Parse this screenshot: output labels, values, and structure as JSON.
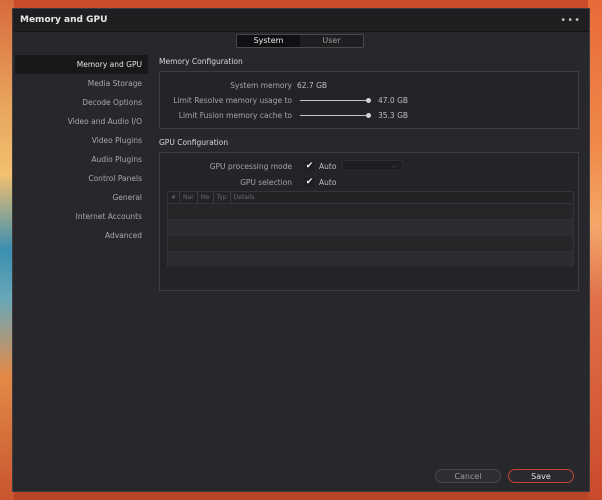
{
  "window": {
    "title": "Memory and GPU",
    "more_icon": "•••"
  },
  "tabs": [
    {
      "label": "System",
      "active": true
    },
    {
      "label": "User",
      "active": false
    }
  ],
  "sidebar": {
    "items": [
      {
        "label": "Memory and GPU",
        "active": true
      },
      {
        "label": "Media Storage"
      },
      {
        "label": "Decode Options"
      },
      {
        "label": "Video and Audio I/O"
      },
      {
        "label": "Video Plugins"
      },
      {
        "label": "Audio Plugins"
      },
      {
        "label": "Control Panels"
      },
      {
        "label": "General"
      },
      {
        "label": "Internet Accounts"
      },
      {
        "label": "Advanced"
      }
    ]
  },
  "memory": {
    "section_title": "Memory Configuration",
    "system_memory_label": "System memory",
    "system_memory_value": "62.7 GB",
    "resolve_label": "Limit Resolve memory usage to",
    "resolve_value": "47.0 GB",
    "resolve_fraction": 1.0,
    "fusion_label": "Limit Fusion memory cache to",
    "fusion_value": "35.3 GB",
    "fusion_fraction": 1.0
  },
  "gpu": {
    "section_title": "GPU Configuration",
    "processing_label": "GPU processing mode",
    "processing_auto_label": "Auto",
    "processing_auto_checked": true,
    "selection_label": "GPU selection",
    "selection_auto_label": "Auto",
    "selection_auto_checked": true,
    "table_columns": [
      "#",
      "Nar",
      "Me",
      "Typ",
      "Details"
    ]
  },
  "buttons": {
    "cancel": "Cancel",
    "save": "Save"
  },
  "colors": {
    "accent_save_border": "#c0443a",
    "window_bg": "#28282c",
    "titlebar_bg": "#1f1f22"
  }
}
